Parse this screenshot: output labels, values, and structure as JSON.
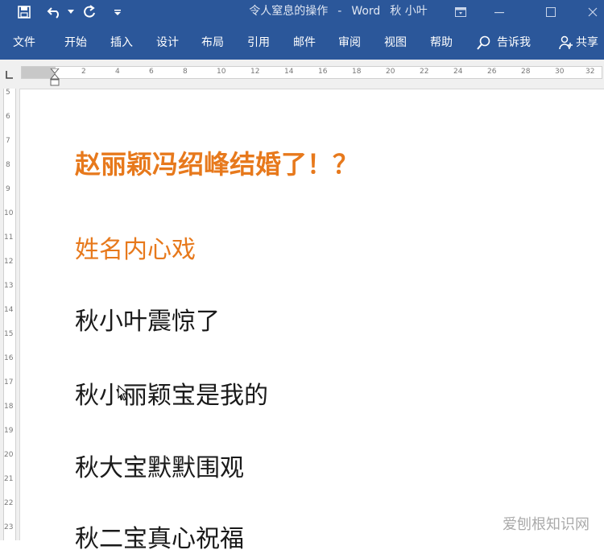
{
  "window": {
    "doc_title": "令人窒息的操作",
    "separator": "-",
    "app_name": "Word",
    "user": "秋 小叶"
  },
  "ribbon": {
    "tabs": [
      "文件",
      "开始",
      "插入",
      "设计",
      "布局",
      "引用",
      "邮件",
      "审阅",
      "视图",
      "帮助"
    ],
    "tell_me": "告诉我",
    "share": "共享"
  },
  "ruler": {
    "h_labels": [
      "2",
      "4",
      "6",
      "8",
      "10",
      "12",
      "14",
      "16",
      "18",
      "20",
      "22",
      "24",
      "26",
      "28",
      "30",
      "32"
    ],
    "v_labels": [
      "5",
      "6",
      "7",
      "8",
      "9",
      "10",
      "11",
      "12",
      "13",
      "14",
      "15",
      "16",
      "17",
      "18",
      "19",
      "20",
      "21",
      "22",
      "23"
    ]
  },
  "document": {
    "title": "赵丽颖冯绍峰结婚了！？",
    "subtitle": "姓名内心戏",
    "lines": [
      "秋小叶震惊了",
      "秋小丽颖宝是我的",
      "秋大宝默默围观",
      "秋二宝真心祝福"
    ]
  },
  "watermark": "爱刨根知识网",
  "colors": {
    "ribbon": "#2b579a",
    "heading": "#e7791c"
  }
}
